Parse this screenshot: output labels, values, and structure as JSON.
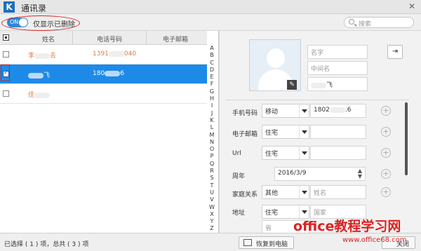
{
  "app": {
    "logo": "K",
    "title": "通讯录"
  },
  "toolbar": {
    "toggle_label": "ON",
    "show_deleted_label": "仅显示已删除",
    "search_placeholder": "搜索"
  },
  "table": {
    "headers": {
      "name": "姓名",
      "phone": "电话号码",
      "email": "电子邮箱"
    },
    "rows": [
      {
        "name": "李",
        "name_tail": "去",
        "phone": "1391",
        "phone_tail": "040",
        "checked": false,
        "selected": false
      },
      {
        "name": "",
        "name_tail": "飞",
        "phone": "180",
        "phone_tail": "6",
        "checked": true,
        "selected": true
      },
      {
        "name": "佳",
        "name_tail": "",
        "phone": "",
        "phone_tail": "",
        "checked": false,
        "selected": false
      }
    ]
  },
  "alphabet": [
    "A",
    "B",
    "C",
    "D",
    "E",
    "F",
    "G",
    "H",
    "I",
    "J",
    "K",
    "L",
    "M",
    "N",
    "O",
    "P",
    "Q",
    "R",
    "S",
    "T",
    "U",
    "V",
    "W",
    "X",
    "Y",
    "Z"
  ],
  "detail": {
    "placeholders": {
      "first_name": "名字",
      "middle_name": "中间名",
      "last_name_tail": "飞"
    },
    "phone": {
      "label": "手机号码",
      "type": "移动",
      "value": "1802",
      "value_tail": ".6"
    },
    "email": {
      "label": "电子邮箱",
      "type": "住宅"
    },
    "url": {
      "label": "Url",
      "type": "住宅"
    },
    "anniversary": {
      "label": "周年",
      "value": "2016/3/9"
    },
    "relation": {
      "label": "家庭关系",
      "type": "其他",
      "placeholder": "姓名"
    },
    "address": {
      "label": "地址",
      "type": "住宅",
      "placeholder": "国家",
      "province_placeholder": "省"
    }
  },
  "status": {
    "text": "已选择 ( 1 ) 项，总共 ( 3 ) 项",
    "restore_button": "恢复到电脑",
    "close_button": "关闭"
  },
  "watermark": {
    "line1": "office教程学习网",
    "line2": "www.office68.com"
  },
  "colors": {
    "selection": "#1e8ae8",
    "annotation": "#d62020",
    "accent": "#2f86d6"
  }
}
